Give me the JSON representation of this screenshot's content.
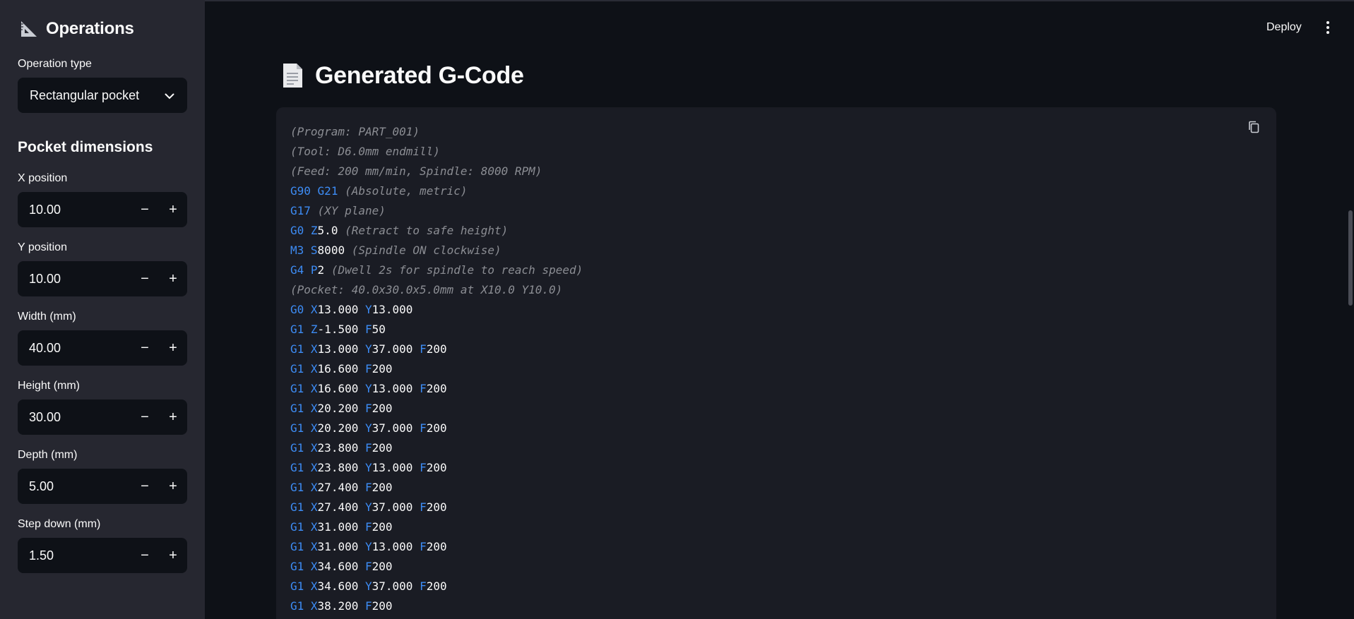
{
  "sidebar": {
    "title": "Operations",
    "title_icon": "triangular-ruler-icon",
    "operation_type_label": "Operation type",
    "operation_type_value": "Rectangular pocket",
    "section_heading": "Pocket dimensions",
    "fields": [
      {
        "label": "X position",
        "value": "10.00"
      },
      {
        "label": "Y position",
        "value": "10.00"
      },
      {
        "label": "Width (mm)",
        "value": "40.00"
      },
      {
        "label": "Height (mm)",
        "value": "30.00"
      },
      {
        "label": "Depth (mm)",
        "value": "5.00"
      },
      {
        "label": "Step down (mm)",
        "value": "1.50"
      }
    ],
    "minus_label": "−",
    "plus_label": "+"
  },
  "header": {
    "deploy_label": "Deploy"
  },
  "main": {
    "title": "Generated G-Code",
    "title_icon": "document-icon",
    "code_lines": [
      [
        [
          "c",
          "(Program: PART_001)"
        ]
      ],
      [
        [
          "c",
          "(Tool: D6.0mm endmill)"
        ]
      ],
      [
        [
          "c",
          "(Feed: 200 mm/min, Spindle: 8000 RPM)"
        ]
      ],
      [
        [
          "k",
          "G90"
        ],
        [
          "t",
          " "
        ],
        [
          "k",
          "G21"
        ],
        [
          "t",
          " "
        ],
        [
          "c",
          "(Absolute, metric)"
        ]
      ],
      [
        [
          "k",
          "G17"
        ],
        [
          "t",
          " "
        ],
        [
          "c",
          "(XY plane)"
        ]
      ],
      [
        [
          "k",
          "G0"
        ],
        [
          "t",
          " "
        ],
        [
          "k",
          "Z"
        ],
        [
          "n",
          "5.0"
        ],
        [
          "t",
          " "
        ],
        [
          "c",
          "(Retract to safe height)"
        ]
      ],
      [
        [
          "k",
          "M3"
        ],
        [
          "t",
          " "
        ],
        [
          "k",
          "S"
        ],
        [
          "n",
          "8000"
        ],
        [
          "t",
          " "
        ],
        [
          "c",
          "(Spindle ON clockwise)"
        ]
      ],
      [
        [
          "k",
          "G4"
        ],
        [
          "t",
          " "
        ],
        [
          "k",
          "P"
        ],
        [
          "n",
          "2"
        ],
        [
          "t",
          " "
        ],
        [
          "c",
          "(Dwell 2s for spindle to reach speed)"
        ]
      ],
      [
        [
          "c",
          "(Pocket: 40.0x30.0x5.0mm at X10.0 Y10.0)"
        ]
      ],
      [
        [
          "k",
          "G0"
        ],
        [
          "t",
          " "
        ],
        [
          "k",
          "X"
        ],
        [
          "n",
          "13.000"
        ],
        [
          "t",
          " "
        ],
        [
          "k",
          "Y"
        ],
        [
          "n",
          "13.000"
        ]
      ],
      [
        [
          "k",
          "G1"
        ],
        [
          "t",
          " "
        ],
        [
          "k",
          "Z"
        ],
        [
          "n",
          "-1.500"
        ],
        [
          "t",
          " "
        ],
        [
          "k",
          "F"
        ],
        [
          "n",
          "50"
        ]
      ],
      [
        [
          "k",
          "G1"
        ],
        [
          "t",
          " "
        ],
        [
          "k",
          "X"
        ],
        [
          "n",
          "13.000"
        ],
        [
          "t",
          " "
        ],
        [
          "k",
          "Y"
        ],
        [
          "n",
          "37.000"
        ],
        [
          "t",
          " "
        ],
        [
          "k",
          "F"
        ],
        [
          "n",
          "200"
        ]
      ],
      [
        [
          "k",
          "G1"
        ],
        [
          "t",
          " "
        ],
        [
          "k",
          "X"
        ],
        [
          "n",
          "16.600"
        ],
        [
          "t",
          " "
        ],
        [
          "k",
          "F"
        ],
        [
          "n",
          "200"
        ]
      ],
      [
        [
          "k",
          "G1"
        ],
        [
          "t",
          " "
        ],
        [
          "k",
          "X"
        ],
        [
          "n",
          "16.600"
        ],
        [
          "t",
          " "
        ],
        [
          "k",
          "Y"
        ],
        [
          "n",
          "13.000"
        ],
        [
          "t",
          " "
        ],
        [
          "k",
          "F"
        ],
        [
          "n",
          "200"
        ]
      ],
      [
        [
          "k",
          "G1"
        ],
        [
          "t",
          " "
        ],
        [
          "k",
          "X"
        ],
        [
          "n",
          "20.200"
        ],
        [
          "t",
          " "
        ],
        [
          "k",
          "F"
        ],
        [
          "n",
          "200"
        ]
      ],
      [
        [
          "k",
          "G1"
        ],
        [
          "t",
          " "
        ],
        [
          "k",
          "X"
        ],
        [
          "n",
          "20.200"
        ],
        [
          "t",
          " "
        ],
        [
          "k",
          "Y"
        ],
        [
          "n",
          "37.000"
        ],
        [
          "t",
          " "
        ],
        [
          "k",
          "F"
        ],
        [
          "n",
          "200"
        ]
      ],
      [
        [
          "k",
          "G1"
        ],
        [
          "t",
          " "
        ],
        [
          "k",
          "X"
        ],
        [
          "n",
          "23.800"
        ],
        [
          "t",
          " "
        ],
        [
          "k",
          "F"
        ],
        [
          "n",
          "200"
        ]
      ],
      [
        [
          "k",
          "G1"
        ],
        [
          "t",
          " "
        ],
        [
          "k",
          "X"
        ],
        [
          "n",
          "23.800"
        ],
        [
          "t",
          " "
        ],
        [
          "k",
          "Y"
        ],
        [
          "n",
          "13.000"
        ],
        [
          "t",
          " "
        ],
        [
          "k",
          "F"
        ],
        [
          "n",
          "200"
        ]
      ],
      [
        [
          "k",
          "G1"
        ],
        [
          "t",
          " "
        ],
        [
          "k",
          "X"
        ],
        [
          "n",
          "27.400"
        ],
        [
          "t",
          " "
        ],
        [
          "k",
          "F"
        ],
        [
          "n",
          "200"
        ]
      ],
      [
        [
          "k",
          "G1"
        ],
        [
          "t",
          " "
        ],
        [
          "k",
          "X"
        ],
        [
          "n",
          "27.400"
        ],
        [
          "t",
          " "
        ],
        [
          "k",
          "Y"
        ],
        [
          "n",
          "37.000"
        ],
        [
          "t",
          " "
        ],
        [
          "k",
          "F"
        ],
        [
          "n",
          "200"
        ]
      ],
      [
        [
          "k",
          "G1"
        ],
        [
          "t",
          " "
        ],
        [
          "k",
          "X"
        ],
        [
          "n",
          "31.000"
        ],
        [
          "t",
          " "
        ],
        [
          "k",
          "F"
        ],
        [
          "n",
          "200"
        ]
      ],
      [
        [
          "k",
          "G1"
        ],
        [
          "t",
          " "
        ],
        [
          "k",
          "X"
        ],
        [
          "n",
          "31.000"
        ],
        [
          "t",
          " "
        ],
        [
          "k",
          "Y"
        ],
        [
          "n",
          "13.000"
        ],
        [
          "t",
          " "
        ],
        [
          "k",
          "F"
        ],
        [
          "n",
          "200"
        ]
      ],
      [
        [
          "k",
          "G1"
        ],
        [
          "t",
          " "
        ],
        [
          "k",
          "X"
        ],
        [
          "n",
          "34.600"
        ],
        [
          "t",
          " "
        ],
        [
          "k",
          "F"
        ],
        [
          "n",
          "200"
        ]
      ],
      [
        [
          "k",
          "G1"
        ],
        [
          "t",
          " "
        ],
        [
          "k",
          "X"
        ],
        [
          "n",
          "34.600"
        ],
        [
          "t",
          " "
        ],
        [
          "k",
          "Y"
        ],
        [
          "n",
          "37.000"
        ],
        [
          "t",
          " "
        ],
        [
          "k",
          "F"
        ],
        [
          "n",
          "200"
        ]
      ],
      [
        [
          "k",
          "G1"
        ],
        [
          "t",
          " "
        ],
        [
          "k",
          "X"
        ],
        [
          "n",
          "38.200"
        ],
        [
          "t",
          " "
        ],
        [
          "k",
          "F"
        ],
        [
          "n",
          "200"
        ]
      ]
    ]
  },
  "colors": {
    "app_bg": "#0e1117",
    "sidebar_bg": "#262730",
    "code_bg": "#1a1c24",
    "gcode_command": "#3d8cf5",
    "gcode_comment": "#8b8d93"
  }
}
